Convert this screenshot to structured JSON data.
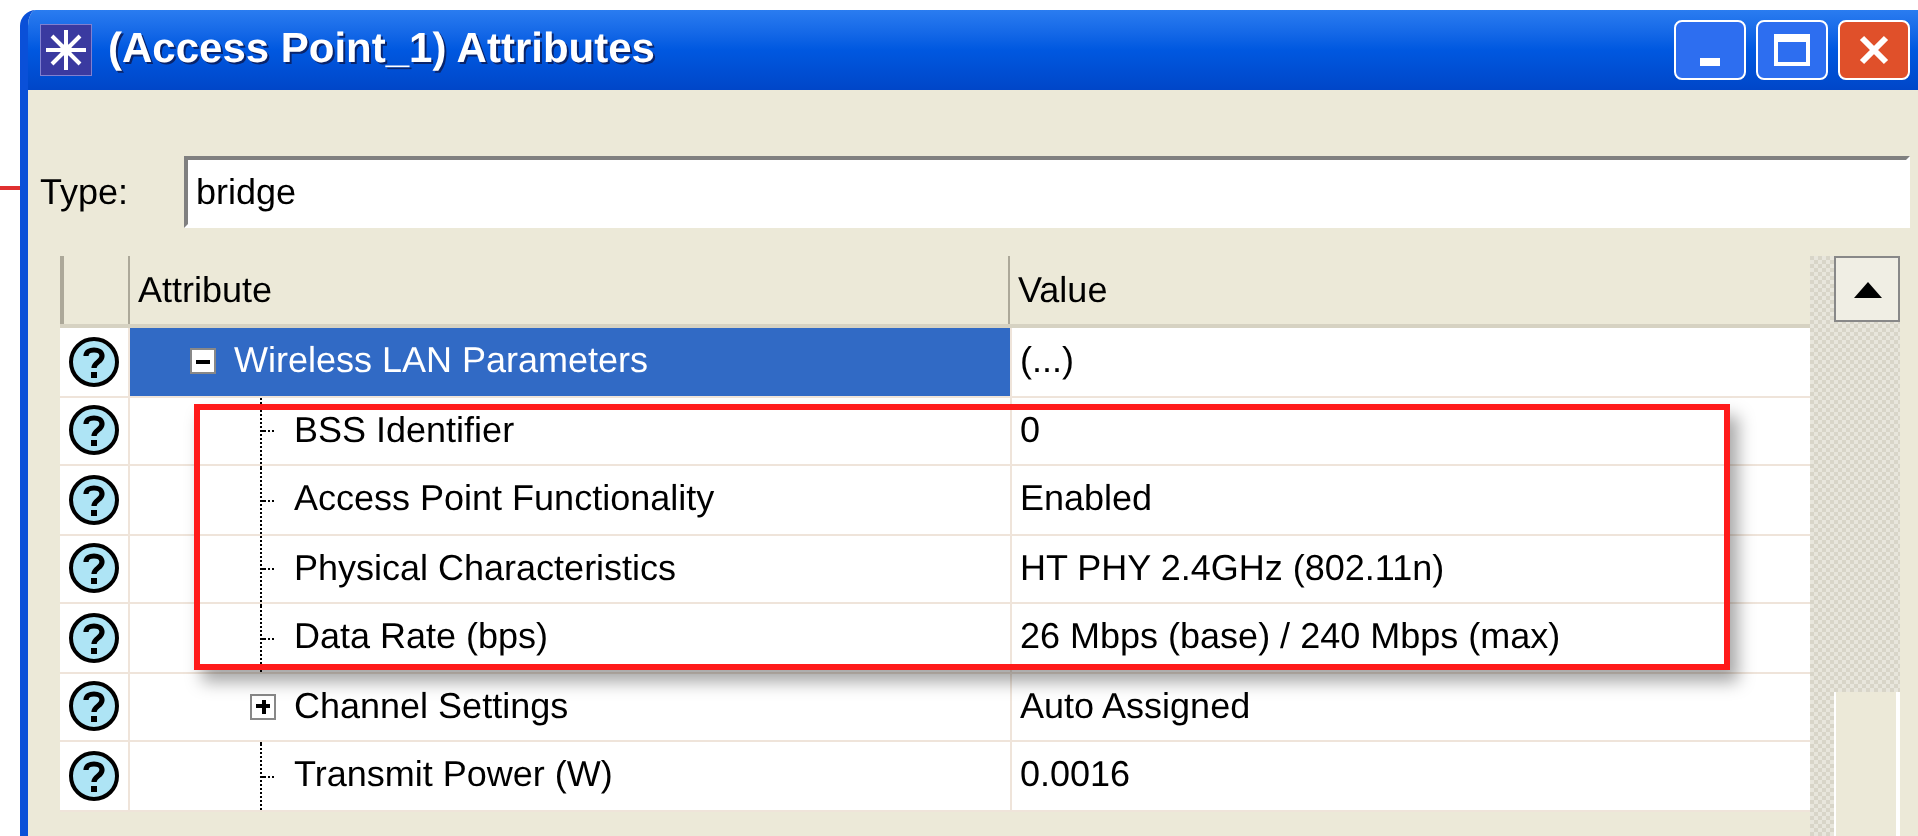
{
  "window": {
    "title": "(Access Point_1) Attributes"
  },
  "type_field": {
    "label": "Type:",
    "value": "bridge"
  },
  "table": {
    "columns": [
      "Attribute",
      "Value"
    ],
    "rows": [
      {
        "kind": "group",
        "attribute": "Wireless LAN Parameters",
        "value": "(...)",
        "expanded": true,
        "selected": true,
        "children": [
          {
            "kind": "leaf",
            "attribute": "BSS Identifier",
            "value": "0",
            "selected": false
          },
          {
            "kind": "leaf",
            "attribute": "Access Point Functionality",
            "value": "Enabled",
            "selected": false
          },
          {
            "kind": "leaf",
            "attribute": "Physical Characteristics",
            "value": "HT PHY 2.4GHz (802.11n)",
            "selected": false
          },
          {
            "kind": "leaf",
            "attribute": "Data Rate (bps)",
            "value": "26 Mbps (base) / 240 Mbps (max)",
            "selected": false
          },
          {
            "kind": "group",
            "attribute": "Channel Settings",
            "value": "Auto Assigned",
            "expanded": false,
            "selected": false
          },
          {
            "kind": "leaf",
            "attribute": "Transmit Power (W)",
            "value": "0.0016",
            "selected": false
          }
        ]
      }
    ]
  }
}
